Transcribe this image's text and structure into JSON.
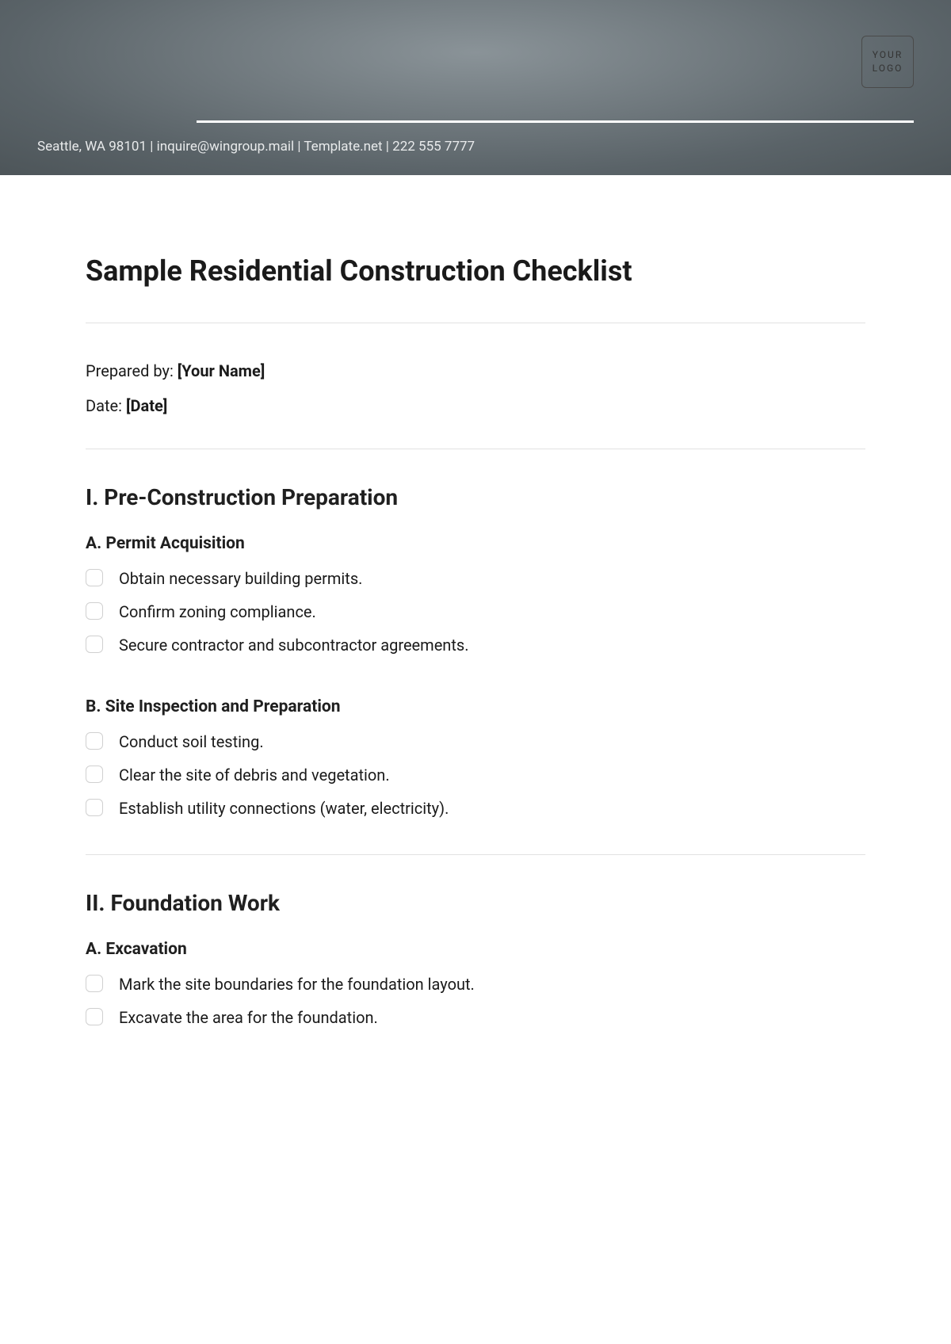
{
  "header": {
    "logo_line1": "YOUR",
    "logo_line2": "LOGO",
    "info": "Seattle, WA 98101 | inquire@wingroup.mail | Template.net | 222 555 7777"
  },
  "document": {
    "title": "Sample Residential Construction Checklist",
    "meta": {
      "prepared_label": "Prepared by: ",
      "prepared_value": "[Your Name]",
      "date_label": "Date: ",
      "date_value": "[Date]"
    },
    "sections": [
      {
        "title": "I. Pre-Construction Preparation",
        "subsections": [
          {
            "title": "A. Permit Acquisition",
            "items": [
              "Obtain necessary building permits.",
              "Confirm zoning compliance.",
              "Secure contractor and subcontractor agreements."
            ]
          },
          {
            "title": "B. Site Inspection and Preparation",
            "items": [
              "Conduct soil testing.",
              "Clear the site of debris and vegetation.",
              "Establish utility connections (water, electricity)."
            ]
          }
        ]
      },
      {
        "title": "II. Foundation Work",
        "subsections": [
          {
            "title": "A. Excavation",
            "items": [
              "Mark the site boundaries for the foundation layout.",
              "Excavate the area for the foundation."
            ]
          }
        ]
      }
    ]
  }
}
